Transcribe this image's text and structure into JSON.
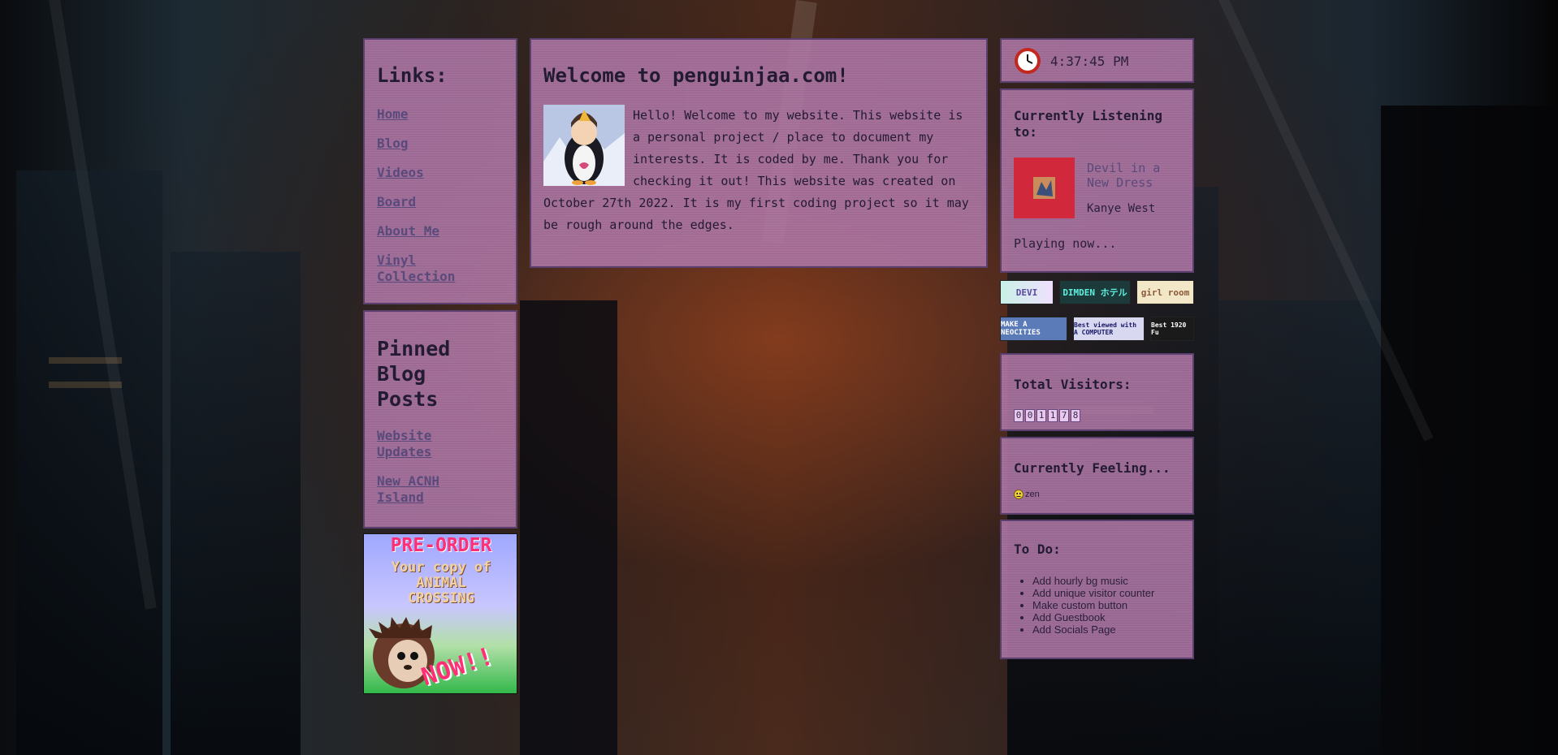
{
  "links_panel": {
    "title": "Links:",
    "items": [
      "Home",
      "Blog",
      "Videos",
      "Board",
      "About Me",
      "Vinyl Collection"
    ]
  },
  "pinned_panel": {
    "title": "Pinned Blog Posts",
    "items": [
      "Website Updates",
      "New ACNH Island"
    ]
  },
  "preorder_ad": {
    "line1": "PRE-ORDER",
    "line2": "Your copy of",
    "line3": "ANIMAL",
    "line4": "CROSSING",
    "line5": "NOW!!"
  },
  "main": {
    "title": "Welcome to penguinjaa.com!",
    "body": "Hello! Welcome to my website. This website is a personal project / place to document my interests. It is coded by me. Thank you for checking it out! This website was created on October 27th 2022. It is my first coding project so it may be rough around the edges."
  },
  "clock": {
    "time": "4:37:45 PM"
  },
  "listening": {
    "title": "Currently Listening to:",
    "song": "Devil in a New Dress",
    "artist": "Kanye West",
    "status": "Playing now..."
  },
  "buttons_row": [
    "DEVI",
    "DIMDEN ホテル",
    "girl room",
    "MAKE A NEOCITIES",
    "Best viewed with A COMPUTER",
    "Best 1920 Fu"
  ],
  "visitors": {
    "title": "Total Visitors:",
    "digits": [
      "0",
      "0",
      "1",
      "1",
      "7",
      "8"
    ]
  },
  "feeling": {
    "title": "Currently Feeling...",
    "mood": "zen"
  },
  "todo": {
    "title": "To Do:",
    "items": [
      "Add hourly bg music",
      "Add unique visitor counter",
      "Make custom button",
      "Add Guestbook",
      "Add Socials Page"
    ]
  },
  "colors": {
    "panel": "#b27aaa",
    "border": "#5b3f6e",
    "link": "#5a4a7c",
    "album": "#d2283c"
  }
}
